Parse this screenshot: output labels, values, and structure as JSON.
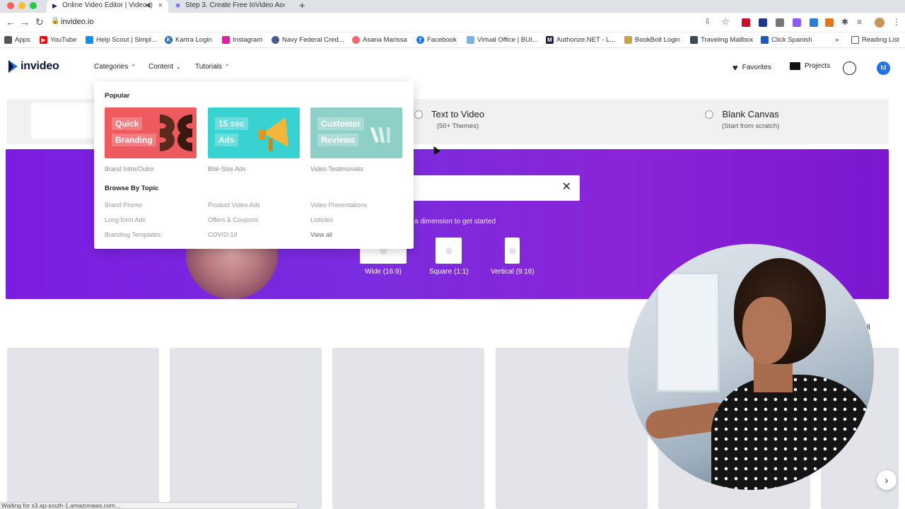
{
  "browser": {
    "tabs": [
      {
        "title": "Online Video Editor | Video",
        "active": true
      },
      {
        "title": "Step 3. Create Free InVideo Ac",
        "active": false
      }
    ],
    "url": "invideo.io",
    "reading_list": "Reading List",
    "bookmarks": [
      {
        "label": "Apps",
        "icon": "apps-grid-icon",
        "color": "#555555"
      },
      {
        "label": "YouTube",
        "icon": "youtube-icon",
        "color": "#ff0000"
      },
      {
        "label": "Help Scout | Simpl...",
        "icon": "helpscout-icon",
        "color": "#1292ee"
      },
      {
        "label": "Kartra Login",
        "icon": "kartra-icon",
        "color": "#1b6dc1"
      },
      {
        "label": "Instagram",
        "icon": "instagram-icon",
        "color": "#d6249f"
      },
      {
        "label": "Navy Federal Cred...",
        "icon": "globe-icon",
        "color": "#4a5a8c"
      },
      {
        "label": "Asana Marissa",
        "icon": "asana-icon",
        "color": "#f06a6a"
      },
      {
        "label": "Facebook",
        "icon": "facebook-icon",
        "color": "#1877f2"
      },
      {
        "label": "Virtual Office | BUI...",
        "icon": "cloud-icon",
        "color": "#7fb2d8"
      },
      {
        "label": "Authorize.NET - L...",
        "icon": "authorize-net-icon",
        "color": "#1c1c3a"
      },
      {
        "label": "BookBolt Login",
        "icon": "bookbolt-icon",
        "color": "#caa24a"
      },
      {
        "label": "Traveling Mailbox",
        "icon": "mailbox-icon",
        "color": "#3b4a57"
      },
      {
        "label": "Click Spanish",
        "icon": "clickspanish-icon",
        "color": "#2456b8"
      }
    ],
    "status": "Waiting for s3.ap-south-1.amazonaws.com..."
  },
  "site": {
    "brand": "invideo",
    "nav": [
      {
        "label": "Categories",
        "chevron": "up"
      },
      {
        "label": "Content",
        "chevron": "down"
      },
      {
        "label": "Tutorials",
        "chevron": "up"
      }
    ],
    "favorites": "Favorites",
    "projects": "Projects",
    "avatar_initial": "M"
  },
  "create_options": [
    {
      "title": "Text to Video",
      "sub": "(50+ Themes)"
    },
    {
      "title": "Blank Canvas",
      "sub": "(Start from scratch)"
    }
  ],
  "banner": {
    "dimension_hint": "a dimension to get started",
    "dimensions": [
      {
        "label": "Wide (16:9)"
      },
      {
        "label": "Square (1:1)"
      },
      {
        "label": "Vertical (9:16)"
      }
    ]
  },
  "dropdown": {
    "popular_heading": "Popular",
    "popular": [
      {
        "tag_lines": [
          "Quick",
          "Branding"
        ],
        "caption": "Brand Intro/Outro",
        "color": "#ef5a5f"
      },
      {
        "tag_lines": [
          "15 sec",
          "Ads"
        ],
        "caption": "Bite-Size Ads",
        "color": "#38d2d0"
      },
      {
        "tag_lines": [
          "Customer",
          "Reviews"
        ],
        "caption": "Video Testimonials",
        "color": "#8ecfc8"
      }
    ],
    "topic_heading": "Browse By Topic",
    "topics": [
      [
        "Brand Promo",
        "Long form Ads",
        "Branding Templates"
      ],
      [
        "Product Video Ads",
        "Offers & Coupons",
        "COVID-19"
      ],
      [
        "Video Presentations",
        "Listicles",
        "View all"
      ]
    ]
  },
  "templates": {
    "view_all": "w All"
  },
  "colors": {
    "brand_purple": "#7b1de0",
    "avatar_blue": "#1a73e8"
  }
}
